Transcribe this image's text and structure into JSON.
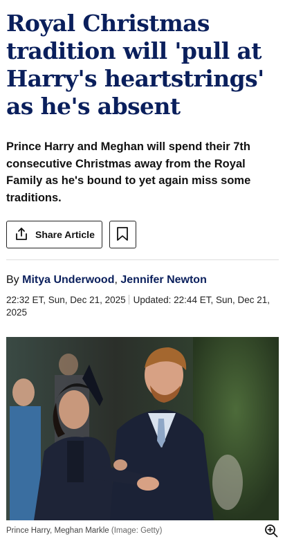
{
  "article": {
    "headline": "Royal Christmas tradition will 'pull at Harry's heartstrings' as he's absent",
    "standfirst": "Prince Harry and Meghan will spend their 7th consecutive Christmas away from the Royal Family as he's bound to yet again miss some traditions."
  },
  "actions": {
    "share_label": "Share Article",
    "share_icon": "share-icon",
    "bookmark_icon": "bookmark-icon"
  },
  "byline": {
    "prefix": "By",
    "author1": "Mitya Underwood",
    "separator": ",",
    "author2": "Jennifer Newton"
  },
  "dates": {
    "published": "22:32 ET, Sun, Dec 21, 2025",
    "updated": "Updated: 22:44 ET, Sun, Dec 21, 2025"
  },
  "image": {
    "caption": "Prince Harry, Meghan Markle",
    "credit": "(Image: Getty)",
    "zoom_icon": "zoom-in-icon"
  },
  "colors": {
    "headline": "#0a1f5c",
    "author_link": "#0a1f5c"
  }
}
